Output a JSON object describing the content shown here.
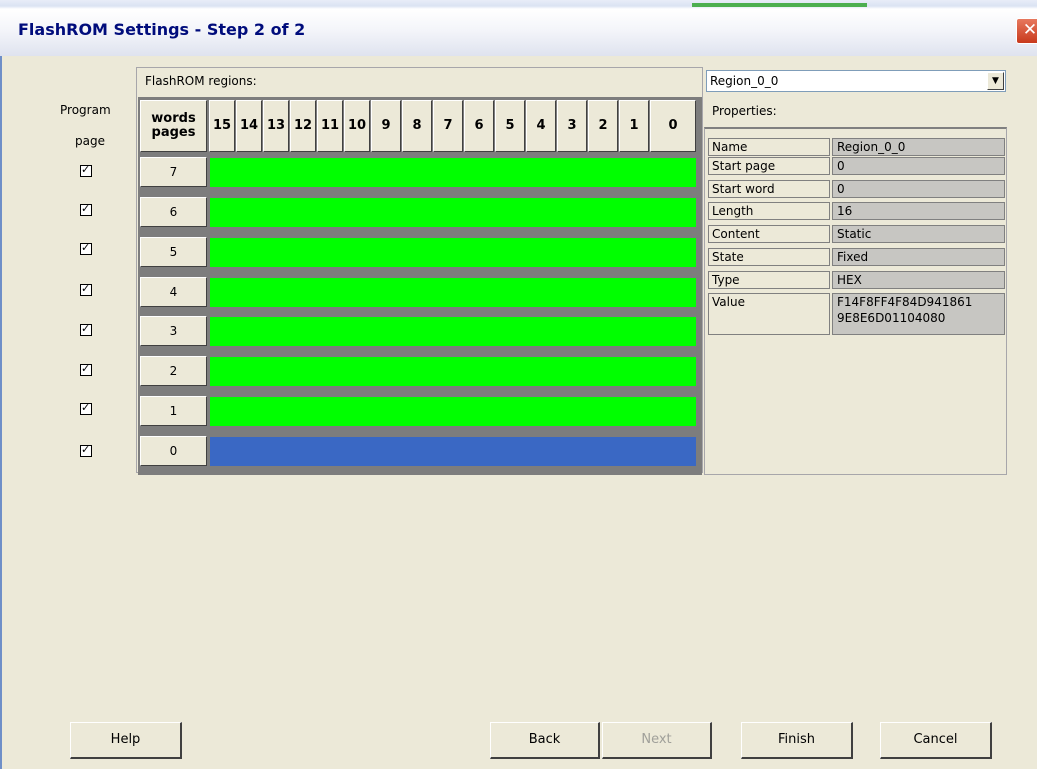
{
  "window": {
    "title": "FlashROM Settings - Step 2 of 2",
    "close_glyph": "✕"
  },
  "left_column": {
    "label_line1": "Program",
    "label_line2": "page"
  },
  "grid": {
    "regions_label": "FlashROM regions:",
    "header_words": "words",
    "header_pages": "pages",
    "word_columns": [
      "15",
      "14",
      "13",
      "12",
      "11",
      "10",
      "9",
      "8",
      "7",
      "6",
      "5",
      "4",
      "3",
      "2",
      "1",
      "0"
    ],
    "pages": [
      {
        "label": "7",
        "checked": true,
        "color": "#00ff00"
      },
      {
        "label": "6",
        "checked": true,
        "color": "#00ff00"
      },
      {
        "label": "5",
        "checked": true,
        "color": "#00ff00"
      },
      {
        "label": "4",
        "checked": true,
        "color": "#00ff00"
      },
      {
        "label": "3",
        "checked": true,
        "color": "#00ff00"
      },
      {
        "label": "2",
        "checked": true,
        "color": "#00ff00"
      },
      {
        "label": "1",
        "checked": true,
        "color": "#00ff00"
      },
      {
        "label": "0",
        "checked": true,
        "color": "#3a68c4"
      }
    ]
  },
  "properties": {
    "region_select": "Region_0_0",
    "label": "Properties:",
    "rows": [
      {
        "name": "Name",
        "value": "Region_0_0"
      },
      {
        "name": "Start page",
        "value": "0"
      },
      {
        "name": "Start word",
        "value": "0"
      },
      {
        "name": "Length",
        "value": "16"
      },
      {
        "name": "Content",
        "value": "Static"
      },
      {
        "name": "State",
        "value": "Fixed"
      },
      {
        "name": "Type",
        "value": "HEX"
      },
      {
        "name": "Value",
        "value": "F14F8FF4F84D941861",
        "value2": "9E8E6D01104080"
      }
    ]
  },
  "buttons": {
    "help": "Help",
    "back": "Back",
    "next": "Next",
    "finish": "Finish",
    "cancel": "Cancel"
  }
}
